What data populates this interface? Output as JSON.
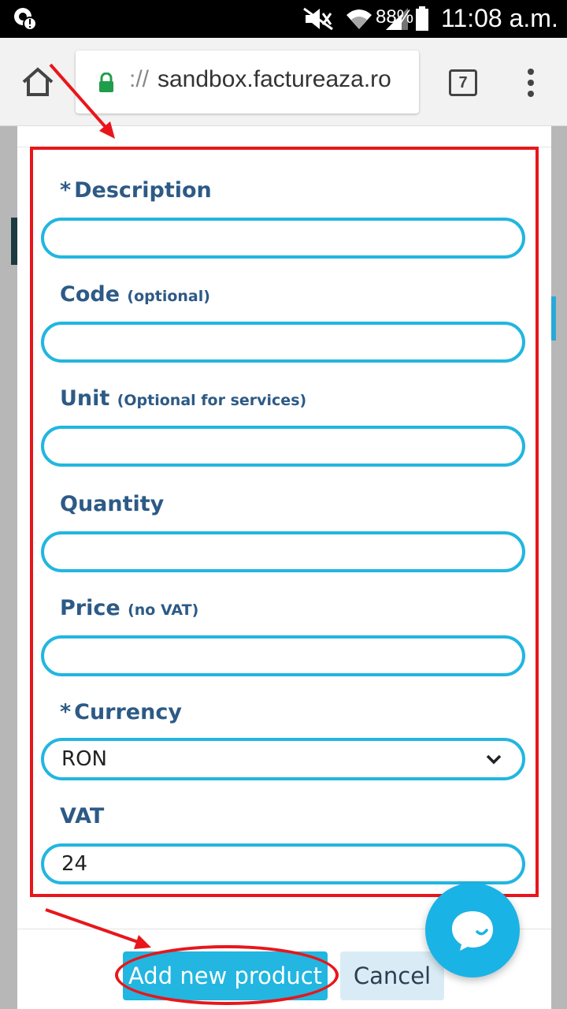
{
  "status_bar": {
    "battery_pct": "88%",
    "time": "11:08 a.m."
  },
  "browser": {
    "url_prefix": "://",
    "url_domain": "sandbox.factureaza.ro",
    "tab_count": "7"
  },
  "form": {
    "description": {
      "required_mark": "*",
      "label": "Description",
      "value": ""
    },
    "code": {
      "label": "Code",
      "hint": "(optional)",
      "value": ""
    },
    "unit": {
      "label": "Unit",
      "hint": "(Optional for services)",
      "value": ""
    },
    "quantity": {
      "label": "Quantity",
      "value": ""
    },
    "price": {
      "label": "Price",
      "hint": "(no VAT)",
      "value": ""
    },
    "currency": {
      "required_mark": "*",
      "label": "Currency",
      "value": "RON"
    },
    "vat": {
      "label": "VAT",
      "value": "24"
    }
  },
  "footer": {
    "add_label": "Add new product",
    "cancel_label": "Cancel"
  },
  "colors": {
    "accent": "#22b6e0",
    "label": "#2d5a86",
    "annotation": "#e8161b"
  }
}
